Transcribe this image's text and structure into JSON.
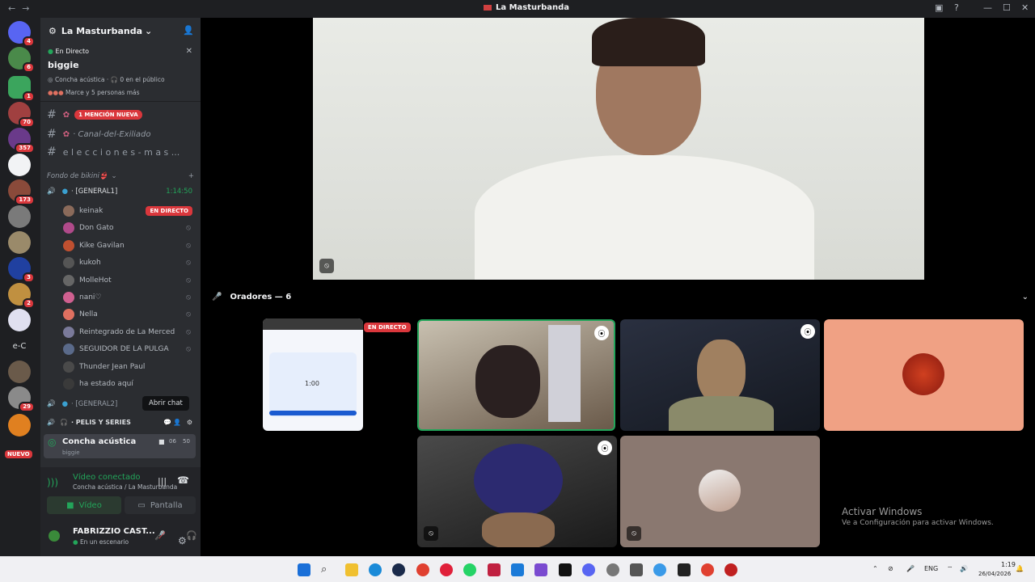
{
  "window": {
    "title": "La Masturbanda"
  },
  "servers": {
    "badges": [
      "4",
      "6",
      "1",
      "70",
      "357",
      "173",
      "3",
      "2",
      "29"
    ],
    "nuevo": "NUEVO",
    "text_item": "e-C"
  },
  "guild": {
    "name": "La Masturbanda"
  },
  "live": {
    "status": "En Directo",
    "user": "biggie",
    "channel": "Concha acústica",
    "audience": "0 en el público",
    "watchers": "Marce y 5 personas más"
  },
  "text_channels": {
    "mention": "1 MENCIÓN NUEVA",
    "exiliado": "· Canal-del-Exiliado",
    "elecciones": "e l e c c i o n e s - m a s ..."
  },
  "category": {
    "name": "Fondo de bikini👙"
  },
  "voice1": {
    "name": "· [GENERAL1]",
    "timer": "1:14:50"
  },
  "members": [
    {
      "name": "keinak",
      "badge": "EN DIRECTO",
      "color": "#8a6a5a"
    },
    {
      "name": "Don Gato",
      "color": "#b04a8a"
    },
    {
      "name": "Kike Gavilan",
      "color": "#c05030"
    },
    {
      "name": "kukoh",
      "color": "#555"
    },
    {
      "name": "MolleHot",
      "color": "#666"
    },
    {
      "name": "nani♡",
      "color": "#d06090"
    },
    {
      "name": "Nella",
      "color": "#e07060"
    },
    {
      "name": "Reintegrado de La Merced",
      "color": "#7a7a9a"
    },
    {
      "name": "SEGUIDOR DE LA PULGA",
      "color": "#5a6a8a"
    },
    {
      "name": "Thunder Jean Paul",
      "color": "#4a4a4a"
    },
    {
      "name": "ha estado aquí",
      "color": "#3a3a3a"
    }
  ],
  "voice2": {
    "name": "· [GENERAL2]"
  },
  "tooltip": "Abrir chat",
  "voice3": {
    "name": "· PELIS Y SERIES"
  },
  "stage": {
    "name": "Concha acústica",
    "sub": "biggie",
    "count1": "06",
    "count2": "50"
  },
  "connection": {
    "status": "Vídeo conectado",
    "detail": "Concha acústica / La Masturbanda",
    "video": "Vídeo",
    "screen": "Pantalla"
  },
  "user": {
    "name": "FABRIZZIO CAST...",
    "status": "En un escenario"
  },
  "speakers": {
    "label": "Oradores — 6"
  },
  "stream_badge": "EN DIRECTO",
  "screen_clock": "1:00",
  "windows": {
    "line1": "Activar Windows",
    "line2": "Ve a Configuración para activar Windows."
  },
  "tray": {
    "lang": "ENG",
    "time": "1:19",
    "date": "26/04/2026"
  },
  "colors": {
    "accent": "#23a55a",
    "danger": "#da373c",
    "blurple": "#5865f2"
  }
}
